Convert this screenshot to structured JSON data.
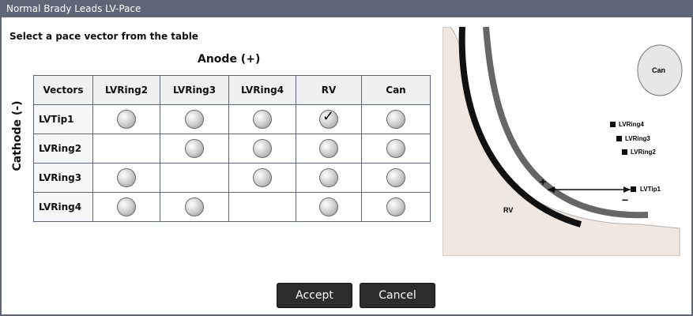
{
  "window": {
    "title": "Normal Brady Leads LV-Pace"
  },
  "instruction": "Select a pace vector from the table",
  "anode_label": "Anode (+)",
  "cathode_label": "Cathode (-)",
  "table": {
    "columns": [
      "Vectors",
      "LVRing2",
      "LVRing3",
      "LVRing4",
      "RV",
      "Can"
    ],
    "rows": [
      {
        "label": "LVTip1",
        "cells": [
          "option",
          "option",
          "option",
          "selected",
          "option"
        ]
      },
      {
        "label": "LVRing2",
        "cells": [
          "none",
          "option",
          "option",
          "option",
          "option"
        ]
      },
      {
        "label": "LVRing3",
        "cells": [
          "option",
          "none",
          "option",
          "option",
          "option"
        ]
      },
      {
        "label": "LVRing4",
        "cells": [
          "option",
          "option",
          "none",
          "option",
          "option"
        ]
      }
    ]
  },
  "diagram": {
    "can_label": "Can",
    "rv_label": "RV",
    "plus": "+",
    "minus": "−",
    "lead_labels": [
      "LVRing4",
      "LVRing3",
      "LVRing2",
      "LVTip1"
    ]
  },
  "buttons": {
    "accept": "Accept",
    "cancel": "Cancel"
  },
  "colors": {
    "titlebar": "#5d6676",
    "button": "#2c2c2c"
  }
}
